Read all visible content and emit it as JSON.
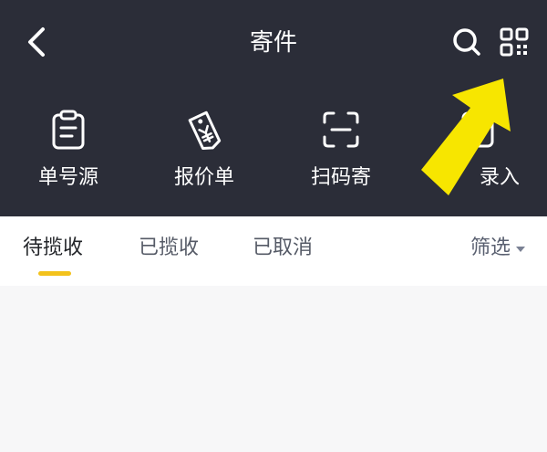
{
  "header": {
    "title": "寄件"
  },
  "tools": [
    {
      "label": "单号源",
      "icon": "clipboard-icon"
    },
    {
      "label": "报价单",
      "icon": "price-tag-icon"
    },
    {
      "label": "扫码寄",
      "icon": "scan-icon"
    },
    {
      "label": "录入",
      "icon": "entry-icon"
    }
  ],
  "tabs": [
    {
      "label": "待揽收",
      "active": true
    },
    {
      "label": "已揽收",
      "active": false
    },
    {
      "label": "已取消",
      "active": false
    }
  ],
  "filter": {
    "label": "筛选"
  },
  "colors": {
    "header_bg": "#2b2d38",
    "accent": "#f3c21c",
    "arrow": "#f7e600"
  }
}
